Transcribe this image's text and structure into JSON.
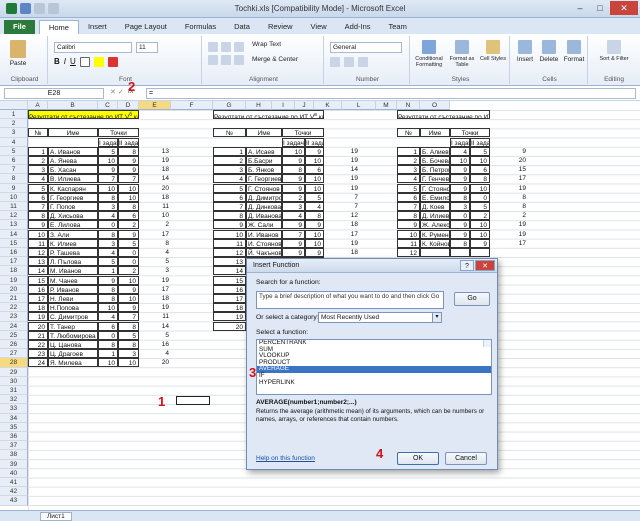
{
  "window": {
    "title": "Tochki.xls  [Compatibility Mode]  -  Microsoft Excel"
  },
  "tabs": [
    "File",
    "Home",
    "Insert",
    "Page Layout",
    "Formulas",
    "Data",
    "Review",
    "View",
    "Add-Ins",
    "Team"
  ],
  "ribbon": {
    "font_name": "Calibri",
    "font_size": "11",
    "wrap_text": "Wrap Text",
    "merge_center": "Merge & Center",
    "number_format": "General",
    "paste": "Paste",
    "conditional_formatting": "Conditional Formatting",
    "format_as_table": "Format as Table",
    "cell_styles": "Cell Styles",
    "insert": "Insert",
    "delete": "Delete",
    "format": "Format",
    "sort_filter": "Sort & Filter",
    "groups": {
      "clipboard": "Clipboard",
      "font": "Font",
      "alignment": "Alignment",
      "number": "Number",
      "styles": "Styles",
      "cells": "Cells",
      "editing": "Editing"
    }
  },
  "formula_bar": {
    "name_box": "E28",
    "fx": "fx",
    "equals": "="
  },
  "columns": [
    "A",
    "B",
    "C",
    "D",
    "E",
    "F",
    "G",
    "H",
    "I",
    "J",
    "K",
    "L",
    "M",
    "N",
    "O"
  ],
  "rows": [
    "1",
    "2",
    "3",
    "4",
    "5",
    "6",
    "7",
    "8",
    "9",
    "10",
    "11",
    "12",
    "13",
    "14",
    "15",
    "16",
    "17",
    "18",
    "19",
    "20",
    "21",
    "22",
    "23",
    "24",
    "25",
    "26",
    "27",
    "28",
    "29",
    "30",
    "31",
    "32",
    "33",
    "34",
    "35",
    "36",
    "37",
    "38",
    "39",
    "40",
    "41",
    "42",
    "43"
  ],
  "table1": {
    "header": "Резултати от състезание по ИТ V",
    "header_sup": "б",
    "header_tail": " клас",
    "col_no": "№",
    "col_name": "Име",
    "points": "Точки",
    "task1": "I задача",
    "task2": "II задача",
    "rows": [
      [
        "1",
        "А. Иванов",
        "5",
        "8",
        "13"
      ],
      [
        "2",
        "А. Янева",
        "10",
        "9",
        "19"
      ],
      [
        "3",
        "Б. Хасан",
        "9",
        "9",
        "18"
      ],
      [
        "4",
        "В. Илиева",
        "7",
        "7",
        "14"
      ],
      [
        "5",
        "К. Каспарян",
        "10",
        "10",
        "20"
      ],
      [
        "6",
        "Г. Георгиев",
        "8",
        "10",
        "18"
      ],
      [
        "7",
        "Г. Попов",
        "3",
        "8",
        "11"
      ],
      [
        "8",
        "Д. Хисьова",
        "4",
        "6",
        "10"
      ],
      [
        "9",
        "Е. Лилова",
        "0",
        "2",
        "2"
      ],
      [
        "10",
        "З. Али",
        "8",
        "9",
        "17"
      ],
      [
        "11",
        "К. Илиев",
        "3",
        "5",
        "8"
      ],
      [
        "12",
        "Р. Ташева",
        "4",
        "0",
        "4"
      ],
      [
        "13",
        "Л. Пълова",
        "5",
        "0",
        "5"
      ],
      [
        "14",
        "М. Иванов",
        "1",
        "2",
        "3"
      ],
      [
        "15",
        "М. Чанев",
        "9",
        "10",
        "19"
      ],
      [
        "16",
        "Р. Иванов",
        "8",
        "9",
        "17"
      ],
      [
        "17",
        "Н. Леви",
        "8",
        "10",
        "18"
      ],
      [
        "18",
        "Н.Попова",
        "10",
        "9",
        "19"
      ],
      [
        "19",
        "С. Димитров",
        "4",
        "7",
        "11"
      ],
      [
        "20",
        "Т. Танер",
        "6",
        "8",
        "14"
      ],
      [
        "21",
        "Т. Любомирова",
        "0",
        "5",
        "5"
      ],
      [
        "22",
        "Ц. Цанова",
        "8",
        "8",
        "16"
      ],
      [
        "23",
        "Ц. Драгоев",
        "1",
        "3",
        "4"
      ],
      [
        "24",
        "Я. Милева",
        "10",
        "10",
        "20"
      ]
    ]
  },
  "table2": {
    "header": "Резултати от състезание по ИТ V",
    "header_sup": "в",
    "header_tail": " клас",
    "col_no": "№",
    "col_name": "Име",
    "points": "Точки",
    "task1": "I задача",
    "task2": "II задача",
    "rows": [
      [
        "1",
        "А. Исаев",
        "10",
        "9",
        "19"
      ],
      [
        "2",
        "Б.Басри",
        "9",
        "10",
        "19"
      ],
      [
        "3",
        "Б. Янков",
        "8",
        "6",
        "14"
      ],
      [
        "4",
        "Г. Георгиев",
        "9",
        "10",
        "19"
      ],
      [
        "5",
        "Г. Стоянов",
        "9",
        "10",
        "19"
      ],
      [
        "6",
        "Д. Димитров",
        "2",
        "5",
        "7"
      ],
      [
        "7",
        "Д. Динкова",
        "3",
        "4",
        "7"
      ],
      [
        "8",
        "Д. Иванова",
        "4",
        "8",
        "12"
      ],
      [
        "9",
        "Ж. Сали",
        "9",
        "9",
        "18"
      ],
      [
        "10",
        "И. Иванов",
        "7",
        "10",
        "17"
      ],
      [
        "11",
        "И. Стоянов",
        "9",
        "10",
        "19"
      ],
      [
        "12",
        "Й. Чакънов",
        "9",
        "9",
        "18"
      ],
      [
        "13",
        "",
        "",
        "",
        ""
      ],
      [
        "14",
        "",
        "",
        "",
        ""
      ],
      [
        "15",
        "",
        "",
        "",
        ""
      ],
      [
        "16",
        "",
        "",
        "",
        ""
      ],
      [
        "17",
        "",
        "",
        "",
        ""
      ],
      [
        "18",
        "",
        "",
        "",
        ""
      ],
      [
        "19",
        "",
        "",
        "",
        ""
      ],
      [
        "20",
        "",
        "",
        "",
        ""
      ]
    ]
  },
  "table3": {
    "header": "Резултати от състезание по ИТ V",
    "header_sup": "г",
    "header_tail": " клас",
    "col_no": "№",
    "col_name": "Име",
    "points": "Точки",
    "task1": "I задача",
    "task2": "II задача",
    "rows": [
      [
        "1",
        "Б. Алиев",
        "4",
        "5",
        "9"
      ],
      [
        "2",
        "Б. Бочева",
        "10",
        "10",
        "20"
      ],
      [
        "3",
        "Б. Петров",
        "9",
        "6",
        "15"
      ],
      [
        "4",
        "Г. Генчев",
        "9",
        "8",
        "17"
      ],
      [
        "5",
        "Г. Стоянов",
        "9",
        "10",
        "19"
      ],
      [
        "6",
        "Е. Емилов",
        "8",
        "0",
        "8"
      ],
      [
        "7",
        "Д. Коев",
        "3",
        "5",
        "8"
      ],
      [
        "8",
        "Д. Илиев",
        "0",
        "2",
        "2"
      ],
      [
        "9",
        "Ж. Алексиева",
        "9",
        "10",
        "19"
      ],
      [
        "10",
        "К. Руменова",
        "9",
        "10",
        "19"
      ],
      [
        "11",
        "К. Койнов",
        "8",
        "9",
        "17"
      ],
      [
        "12",
        "",
        "",
        "",
        ""
      ]
    ]
  },
  "markers": {
    "m1": "1",
    "m2": "2",
    "m3": "3",
    "m4": "4"
  },
  "dialog": {
    "title": "Insert Function",
    "search_label": "Search for a function:",
    "search_text": "Type a brief description of what you want to do and then click Go",
    "go": "Go",
    "category_label": "Or select a category:",
    "category_value": "Most Recently Used",
    "select_label": "Select a function:",
    "functions": [
      "PERCENTRANK",
      "SUM",
      "VLOOKUP",
      "PRODUCT",
      "AVERAGE",
      "IF",
      "HYPERLINK"
    ],
    "selected": "AVERAGE",
    "syntax": "AVERAGE(number1;number2;...)",
    "description": "Returns the average (arithmetic mean) of its arguments, which can be numbers or names, arrays, or references that contain numbers.",
    "help": "Help on this function",
    "ok": "OK",
    "cancel": "Cancel"
  },
  "sheets": [
    "Лист1"
  ]
}
